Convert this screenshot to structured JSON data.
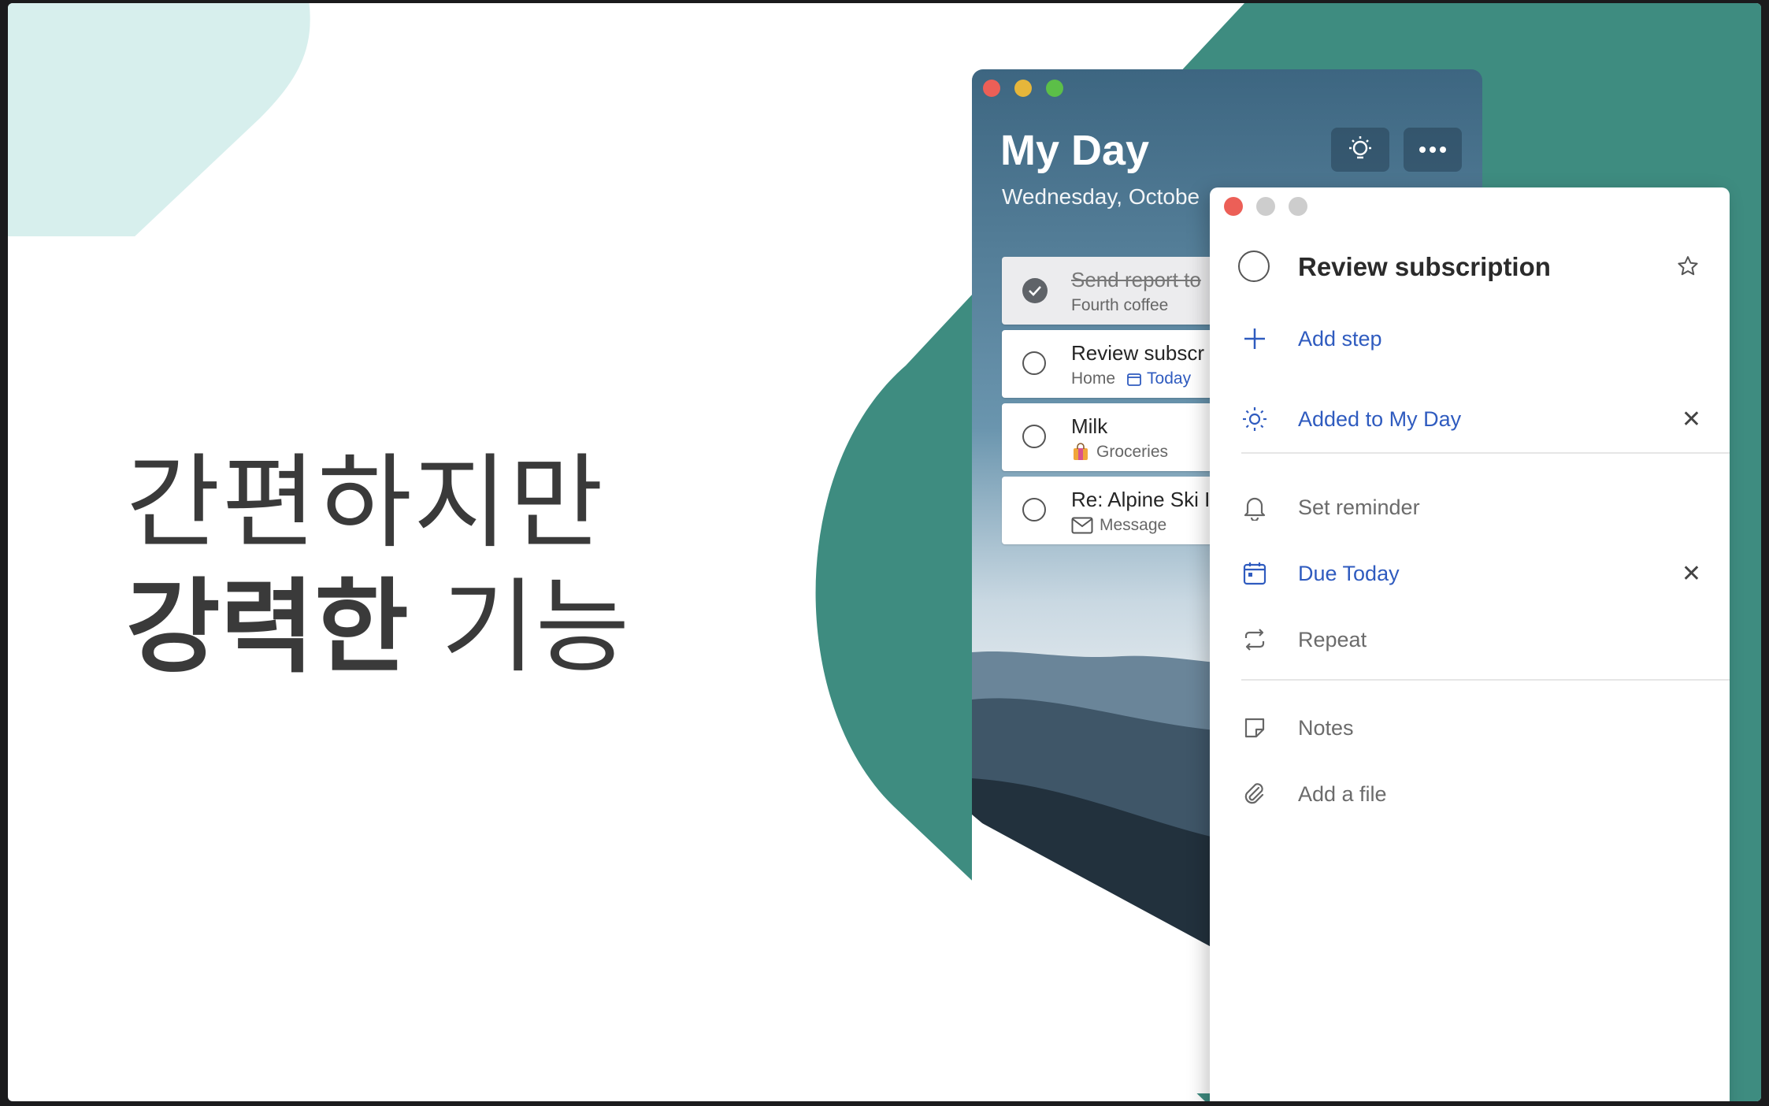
{
  "headline": {
    "line1": "간편하지만",
    "line2_bold": "강력한",
    "line2_rest": "기능"
  },
  "colors": {
    "teal": "#3e8c80",
    "mint": "#d4efed",
    "accent_blue": "#2f5bbf"
  },
  "back_window": {
    "title": "My Day",
    "date": "Wednesday, Octobe",
    "header_buttons": [
      "lightbulb-icon",
      "more-icon"
    ],
    "tasks": [
      {
        "title": "Send report to",
        "subtitle": "Fourth coffee",
        "done": true
      },
      {
        "title": "Review subscr",
        "list": "Home",
        "due": "Today",
        "done": false
      },
      {
        "title": "Milk",
        "list": "Groceries",
        "done": false
      },
      {
        "title": "Re: Alpine Ski I",
        "list": "Message",
        "done": false
      }
    ]
  },
  "detail": {
    "task_title": "Review subscription",
    "add_step": "Add step",
    "my_day": "Added to My Day",
    "reminder": "Set reminder",
    "due": "Due Today",
    "repeat": "Repeat",
    "notes": "Notes",
    "file": "Add a file",
    "remove_symbol": "✕"
  }
}
